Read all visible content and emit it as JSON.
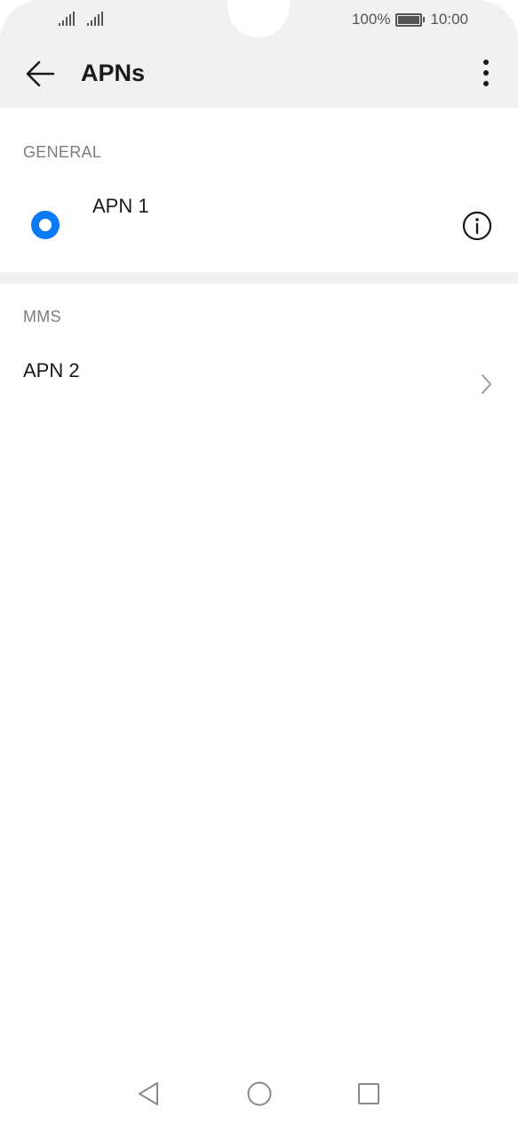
{
  "status_bar": {
    "battery_percent": "100%",
    "time": "10:00",
    "icons": [
      "signal-icon",
      "signal-icon",
      "battery-icon"
    ]
  },
  "app_bar": {
    "title": "APNs",
    "back_icon": "back-arrow-icon",
    "menu_icon": "more-vert-icon"
  },
  "sections": [
    {
      "header": "GENERAL",
      "items": [
        {
          "label": "APN 1",
          "selected": true,
          "trailing_icon": "info-icon"
        }
      ]
    },
    {
      "header": "MMS",
      "items": [
        {
          "label": "APN 2",
          "trailing_icon": "chevron-right-icon"
        }
      ]
    }
  ],
  "nav_bar": {
    "icons": [
      "nav-back-icon",
      "nav-home-icon",
      "nav-recents-icon"
    ]
  },
  "colors": {
    "accent": "#0a7af5",
    "top_background": "#f1f1f1",
    "section_label": "#7d7d7d"
  }
}
